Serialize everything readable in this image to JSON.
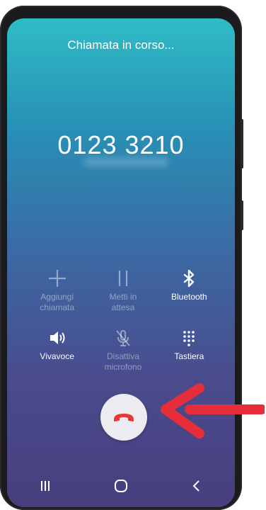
{
  "call": {
    "status_text": "Chiamata in corso...",
    "number": "0123 3210"
  },
  "actions": [
    {
      "label_line1": "Aggiungi",
      "label_line2": "chiamata",
      "icon": "plus-icon",
      "enabled": false
    },
    {
      "label_line1": "Metti in",
      "label_line2": "attesa",
      "icon": "pause-icon",
      "enabled": false
    },
    {
      "label_line1": "Bluetooth",
      "label_line2": "",
      "icon": "bluetooth-icon",
      "enabled": true
    },
    {
      "label_line1": "Vivavoce",
      "label_line2": "",
      "icon": "speaker-icon",
      "enabled": true
    },
    {
      "label_line1": "Disattiva",
      "label_line2": "microfono",
      "icon": "mic-off-icon",
      "enabled": false
    },
    {
      "label_line1": "Tastiera",
      "label_line2": "",
      "icon": "keypad-icon",
      "enabled": true
    }
  ],
  "end_call": {
    "icon": "end-call-icon",
    "icon_color": "#e53935"
  },
  "navbar": {
    "icons": [
      "recent-apps-icon",
      "home-icon",
      "back-icon"
    ]
  },
  "annotation": {
    "icon": "red-arrow-icon",
    "color": "#e62e3a"
  },
  "colors": {
    "disabled_text": "rgba(255,255,255,0.42)",
    "screen_top": "#2fbcc6",
    "screen_bottom": "#473f7e"
  }
}
